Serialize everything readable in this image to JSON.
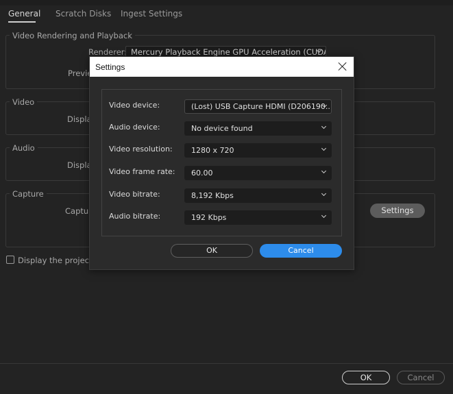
{
  "tabs": [
    {
      "label": "General"
    },
    {
      "label": "Scratch Disks"
    },
    {
      "label": "Ingest Settings"
    }
  ],
  "video_rendering": {
    "group_label": "Video Rendering and Playback",
    "renderer_label": "Renderer:",
    "renderer_value": "Mercury Playback Engine GPU Acceleration (CUDA)",
    "preview_label_partial": "Previe"
  },
  "video_group": {
    "label": "Video",
    "display_partial": "Displa"
  },
  "audio_group": {
    "label": "Audio",
    "display_partial": "Displa"
  },
  "capture_group": {
    "label": "Capture",
    "capture_partial": "Captur",
    "settings_button": "Settings"
  },
  "checkbox_label_partial": "Display the project it",
  "footer": {
    "ok": "OK",
    "cancel": "Cancel"
  },
  "dialog": {
    "title": "Settings",
    "rows": [
      {
        "label": "Video device:",
        "value": "(Lost) USB Capture HDMI (D206190..."
      },
      {
        "label": "Audio device:",
        "value": "No device found"
      },
      {
        "label": "Video resolution:",
        "value": "1280 x 720"
      },
      {
        "label": "Video frame rate:",
        "value": "60.00"
      },
      {
        "label": "Video bitrate:",
        "value": "8,192 Kbps"
      },
      {
        "label": "Audio bitrate:",
        "value": "192 Kbps"
      }
    ],
    "ok": "OK",
    "cancel": "Cancel",
    "accent_color": "#2d8ceb"
  }
}
